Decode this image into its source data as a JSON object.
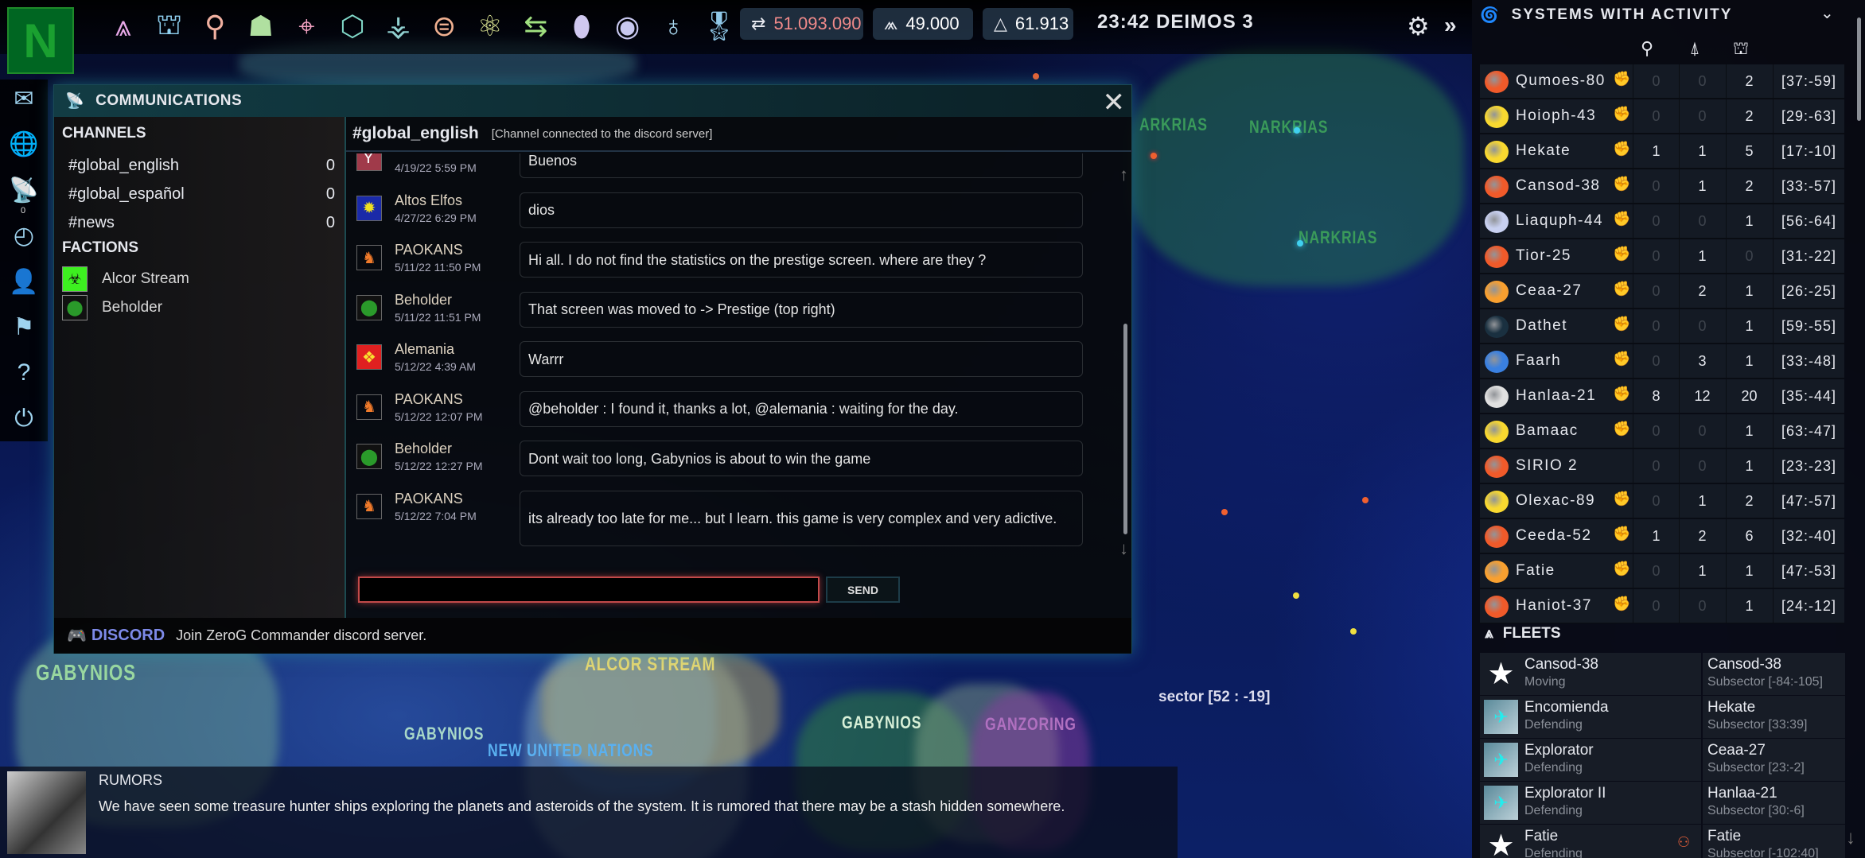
{
  "topbar": {
    "icons": [
      {
        "name": "fleets-icon",
        "glyph": "⩓",
        "color": "#e8a8e8"
      },
      {
        "name": "ships-icon",
        "glyph": "⛫",
        "color": "#8fd0f0"
      },
      {
        "name": "research-icon",
        "glyph": "⚲",
        "color": "#f0b0a0"
      },
      {
        "name": "defense-icon",
        "glyph": "☗",
        "color": "#b0e0a0"
      },
      {
        "name": "target-icon",
        "glyph": "⌖",
        "color": "#f0a0c0"
      },
      {
        "name": "network-icon",
        "glyph": "⬡",
        "color": "#80d8c8"
      },
      {
        "name": "tree-icon",
        "glyph": "⚶",
        "color": "#90d0d0"
      },
      {
        "name": "circuit-icon",
        "glyph": "⊜",
        "color": "#f0b090"
      },
      {
        "name": "atom-icon",
        "glyph": "⚛",
        "color": "#d8e090"
      },
      {
        "name": "trade-icon",
        "glyph": "⇆",
        "color": "#a0e080"
      },
      {
        "name": "acorn-icon",
        "glyph": "⬮",
        "color": "#d0c8f0"
      },
      {
        "name": "eye-icon",
        "glyph": "◉",
        "color": "#c8c8f0"
      },
      {
        "name": "planet-icon",
        "glyph": "♁",
        "color": "#a8d8f0"
      },
      {
        "name": "medal-icon",
        "glyph": "🎖",
        "color": "#90c8e8"
      }
    ],
    "resources": [
      {
        "name": "credits",
        "icon": "⇄",
        "value": "51.093.090",
        "color": "#f08a8a"
      },
      {
        "name": "population",
        "icon": "⩕",
        "value": "49.000",
        "color": "#ffffff"
      },
      {
        "name": "prestige",
        "icon": "△",
        "value": "61.913",
        "color": "#ffffff"
      }
    ],
    "clock": "23:42 DEIMOS 3"
  },
  "sidebar": [
    {
      "name": "mail-icon",
      "glyph": "✉"
    },
    {
      "name": "news-icon",
      "glyph": "🌐"
    },
    {
      "name": "communications-icon",
      "glyph": "📡",
      "badge": "0"
    },
    {
      "name": "history-icon",
      "glyph": "◴"
    },
    {
      "name": "support-icon",
      "glyph": "👤"
    },
    {
      "name": "flag-icon",
      "glyph": "⚑"
    },
    {
      "name": "help-icon",
      "glyph": "?"
    },
    {
      "name": "power-icon",
      "glyph": "⏻"
    }
  ],
  "comm": {
    "title": "COMMUNICATIONS",
    "channels_label": "CHANNELS",
    "channels": [
      {
        "name": "#global_english",
        "count": "0"
      },
      {
        "name": "#global_español",
        "count": "0"
      },
      {
        "name": "#news",
        "count": "0"
      }
    ],
    "factions_label": "FACTIONS",
    "factions": [
      {
        "name": "Alcor Stream",
        "glyph": "☣",
        "bg": "#3df020",
        "fg": "#111"
      },
      {
        "name": "Beholder",
        "glyph": "⬤",
        "bg": "#111",
        "fg": "#2a9a2a"
      }
    ],
    "active_channel": "#global_english",
    "channel_status": "[Channel connected to the discord server]",
    "messages": [
      {
        "author": "",
        "time": "4/19/22 5:59 PM",
        "text": "Buenos",
        "glyph": "Ƴ",
        "bg": "#a03a4a",
        "fg": "#fff"
      },
      {
        "author": "Altos Elfos",
        "time": "4/27/22 6:29 PM",
        "text": "dios",
        "glyph": "✹",
        "bg": "#1a2aa8",
        "fg": "#f0e020"
      },
      {
        "author": "PAOKANS",
        "time": "5/11/22 11:50 PM",
        "text": "Hi all. I do not find the statistics on the prestige screen. where are they ?",
        "glyph": "♞",
        "bg": "transparent",
        "fg": "#f07a2a"
      },
      {
        "author": "Beholder",
        "time": "5/11/22 11:51 PM",
        "text": "That screen was moved to -> Prestige (top right)",
        "glyph": "⬤",
        "bg": "#111",
        "fg": "#2a9a2a"
      },
      {
        "author": "Alemania",
        "time": "5/12/22 4:39 AM",
        "text": "Warrr",
        "glyph": "❖",
        "bg": "#e02020",
        "fg": "#f8e030"
      },
      {
        "author": "PAOKANS",
        "time": "5/12/22 12:07 PM",
        "text": "@beholder : I found it, thanks a lot, @alemania : waiting for the day.",
        "glyph": "♞",
        "bg": "transparent",
        "fg": "#f07a2a"
      },
      {
        "author": "Beholder",
        "time": "5/12/22 12:27 PM",
        "text": "Dont wait too long, Gabynios is about to win the game",
        "glyph": "⬤",
        "bg": "#111",
        "fg": "#2a9a2a"
      },
      {
        "author": "PAOKANS",
        "time": "5/12/22 7:04 PM",
        "text": "its already too late for me... but I learn. this game is very complex and very adictive.",
        "glyph": "♞",
        "bg": "transparent",
        "fg": "#f07a2a"
      }
    ],
    "input_value": "",
    "send_label": "SEND",
    "discord_brand": "DISCORD",
    "discord_text": "Join ZeroG Commander discord server."
  },
  "map": {
    "labels": [
      {
        "text": "GABYNIOS",
        "color": "#9ad8a0"
      },
      {
        "text": "ALCOR STREAM",
        "color": "#e8d870"
      },
      {
        "text": "GABYNIOS",
        "color": "#a8d8c8"
      },
      {
        "text": "NEW UNITED NATIONS",
        "color": "#5ab0f0"
      },
      {
        "text": "GABYNIOS",
        "color": "#d8f0d8"
      },
      {
        "text": "GANZORING",
        "color": "#b070c0"
      },
      {
        "text": "NARKRIAS",
        "color": "#3a9a5a"
      },
      {
        "text": "NARKRIAS",
        "color": "#3a9a5a"
      },
      {
        "text": "ARKRIAS",
        "color": "#3a9a5a"
      }
    ],
    "sector": "sector [52 : -19]"
  },
  "rumors": {
    "title": "RUMORS",
    "text": "We have seen some treasure hunter ships exploring the planets and asteroids of the system. It is rumored that there may be a stash hidden somewhere."
  },
  "systems": {
    "title": "SYSTEMS WITH ACTIVITY",
    "columns": [
      "planets-icon",
      "ships-icon",
      "fleets-icon"
    ],
    "rows": [
      {
        "name": "Qumoes-80",
        "star": "#f05a2a",
        "fist": "#ffffff",
        "a": "0",
        "b": "0",
        "c": "2",
        "coords": "[37:-59]"
      },
      {
        "name": "Hoioph-43",
        "star": "#f8d830",
        "fist": "#ffffff",
        "a": "0",
        "b": "0",
        "c": "2",
        "coords": "[29:-63]"
      },
      {
        "name": "Hekate",
        "star": "#f8d830",
        "fist": "#ffffff",
        "a": "1",
        "b": "1",
        "c": "5",
        "coords": "[17:-10]"
      },
      {
        "name": "Cansod-38",
        "star": "#f05a2a",
        "fist": "#ffffff",
        "a": "0",
        "b": "1",
        "c": "2",
        "coords": "[33:-57]"
      },
      {
        "name": "Liaquph-44",
        "star": "#c8d0f0",
        "fist": "#ffffff",
        "a": "0",
        "b": "0",
        "c": "1",
        "coords": "[56:-64]"
      },
      {
        "name": "Tior-25",
        "star": "#f05a2a",
        "fist": "#e8602a",
        "a": "0",
        "b": "1",
        "c": "0",
        "coords": "[31:-22]"
      },
      {
        "name": "Ceaa-27",
        "star": "#f8a030",
        "fist": "#ffffff",
        "a": "0",
        "b": "2",
        "c": "1",
        "coords": "[26:-25]"
      },
      {
        "name": "Dathet",
        "star": "#1a3040",
        "fist": "#ffffff",
        "a": "0",
        "b": "0",
        "c": "1",
        "coords": "[59:-55]"
      },
      {
        "name": "Faarh",
        "star": "#3a80e0",
        "fist": "#ffffff",
        "a": "0",
        "b": "3",
        "c": "1",
        "coords": "[33:-48]"
      },
      {
        "name": "Hanlaa-21",
        "star": "#e0e0e0",
        "fist": "#ffffff",
        "a": "8",
        "b": "12",
        "c": "20",
        "coords": "[35:-44]"
      },
      {
        "name": "Bamaac",
        "star": "#f8d830",
        "fist": "#ffffff",
        "a": "0",
        "b": "0",
        "c": "1",
        "coords": "[63:-47]"
      },
      {
        "name": "SIRIO 2",
        "star": "#f05a2a",
        "fist": "",
        "a": "0",
        "b": "0",
        "c": "1",
        "coords": "[23:-23]"
      },
      {
        "name": "Olexac-89",
        "star": "#f8d830",
        "fist": "#ffffff",
        "a": "0",
        "b": "1",
        "c": "2",
        "coords": "[47:-57]"
      },
      {
        "name": "Ceeda-52",
        "star": "#f05a2a",
        "fist": "#ffffff",
        "a": "1",
        "b": "2",
        "c": "6",
        "coords": "[32:-40]"
      },
      {
        "name": "Fatie",
        "star": "#f8a030",
        "fist": "#ffffff",
        "a": "0",
        "b": "1",
        "c": "1",
        "coords": "[47:-53]"
      },
      {
        "name": "Haniot-37",
        "star": "#f05a2a",
        "fist": "#e8602a",
        "a": "0",
        "b": "0",
        "c": "1",
        "coords": "[24:-12]"
      }
    ]
  },
  "fleets": {
    "title": "FLEETS",
    "rows": [
      {
        "name": "Cansod-38",
        "status": "Moving",
        "location": "Cansod-38",
        "subsector": "Subsector [-84:-105]",
        "avatar": "star",
        "group": false
      },
      {
        "name": "Encomienda",
        "status": "Defending",
        "location": "Hekate",
        "subsector": "Subsector [33:39]",
        "avatar": "ship",
        "group": false
      },
      {
        "name": "Explorator",
        "status": "Defending",
        "location": "Ceaa-27",
        "subsector": "Subsector [23:-2]",
        "avatar": "ship",
        "group": false
      },
      {
        "name": "Explorator II",
        "status": "Defending",
        "location": "Hanlaa-21",
        "subsector": "Subsector [30:-6]",
        "avatar": "ship",
        "group": false
      },
      {
        "name": "Fatie",
        "status": "Defending",
        "location": "Fatie",
        "subsector": "Subsector [-102:40]",
        "avatar": "star",
        "group": true
      }
    ]
  }
}
